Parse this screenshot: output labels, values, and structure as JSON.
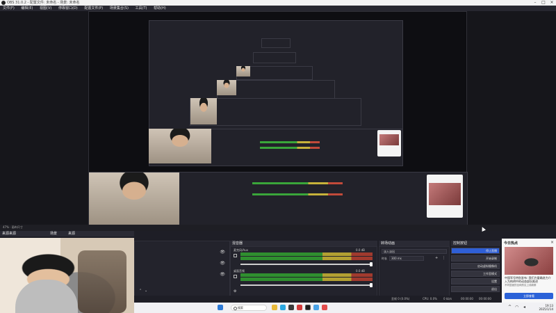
{
  "window": {
    "title": "OBS 31.0.2 - 配置文件: 未命名 - 场景: 未命名"
  },
  "menu": [
    "文件(F)",
    "编辑(E)",
    "视图(V)",
    "停靠窗口(D)",
    "配置文件(P)",
    "场景集合(S)",
    "工具(T)",
    "帮助(H)"
  ],
  "preview": {
    "zoom_label": "47% · 画布尺寸"
  },
  "scene_dock": {
    "title": "来源来源",
    "tabs": [
      "场景",
      "来源"
    ]
  },
  "audio_mixer": {
    "title": "混音器",
    "channels": [
      {
        "name": "麦克风/Aux",
        "db": "0.0 dB"
      },
      {
        "name": "桌面音频",
        "db": "0.0 dB"
      }
    ],
    "scale": [
      "-60",
      "-55",
      "-50",
      "-45",
      "-40",
      "-35",
      "-30",
      "-25",
      "-20",
      "-15",
      "-10",
      "-5",
      "0"
    ]
  },
  "transitions_dock": {
    "title": "转场动画",
    "transition": "淡入淡出",
    "duration_label": "时长",
    "duration": "300 ms"
  },
  "controls_dock": {
    "title": "控制按钮",
    "buttons": [
      "停止直播",
      "开始录制",
      "启动虚拟摄像机",
      "工作室模式",
      "设置",
      "退出"
    ]
  },
  "status": {
    "dropped": "丢帧 0 (0.0%)",
    "cpu": "CPU: 0.0%",
    "kbps": "0 kb/s",
    "time": "00:00:00",
    "rec": "00:00:00",
    "fps": "60.00 / 60.00 FPS"
  },
  "taskbar": {
    "search_placeholder": "搜索",
    "time": "19:13",
    "date": "2025/1/14"
  },
  "toast": {
    "header": "今日热点",
    "headline": "中国军号特别发布: 我们力量确进力介入为构明中的动态部队推进",
    "sub": "不同层面的全网热议上线新鲜",
    "button": "立即查看",
    "close": "×"
  },
  "colors": {
    "accent": "#2f5fd6",
    "meter_green": "#2f8f2f",
    "meter_yellow": "#b3a032",
    "meter_red": "#a13a2e"
  }
}
